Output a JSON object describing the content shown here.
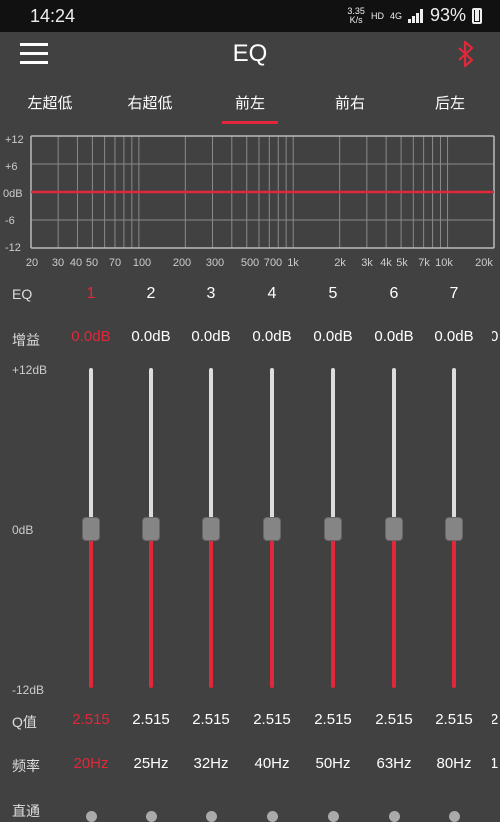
{
  "status": {
    "time": "14:24",
    "net_speed_top": "3.35",
    "net_speed_bottom": "K/s",
    "hd": "HD",
    "signal": "4G",
    "battery": "93%"
  },
  "app": {
    "title": "EQ"
  },
  "tabs": [
    "左超低",
    "右超低",
    "前左",
    "前右",
    "后左"
  ],
  "active_tab": 2,
  "graph": {
    "y_labels": [
      "+12",
      "+6",
      "0dB",
      "-6",
      "-12"
    ],
    "x_labels": [
      "20",
      "30",
      "40",
      "50",
      "70",
      "100",
      "200",
      "300",
      "500",
      "700",
      "1k",
      "2k",
      "3k",
      "4k",
      "5k",
      "7k",
      "10k",
      "20k"
    ]
  },
  "labels": {
    "eq": "EQ",
    "gain": "增益",
    "q": "Q值",
    "freq": "频率",
    "direct": "直通",
    "db_top": "+12dB",
    "db_mid": "0dB",
    "db_bot": "-12dB"
  },
  "bands": [
    {
      "num": "1",
      "gain": "0.0dB",
      "q": "2.515",
      "freq": "20Hz"
    },
    {
      "num": "2",
      "gain": "0.0dB",
      "q": "2.515",
      "freq": "25Hz"
    },
    {
      "num": "3",
      "gain": "0.0dB",
      "q": "2.515",
      "freq": "32Hz"
    },
    {
      "num": "4",
      "gain": "0.0dB",
      "q": "2.515",
      "freq": "40Hz"
    },
    {
      "num": "5",
      "gain": "0.0dB",
      "q": "2.515",
      "freq": "50Hz"
    },
    {
      "num": "6",
      "gain": "0.0dB",
      "q": "2.515",
      "freq": "63Hz"
    },
    {
      "num": "7",
      "gain": "0.0dB",
      "q": "2.515",
      "freq": "80Hz"
    }
  ],
  "selected_band": 0,
  "colors": {
    "accent": "#e0283a",
    "background": "#414141"
  }
}
